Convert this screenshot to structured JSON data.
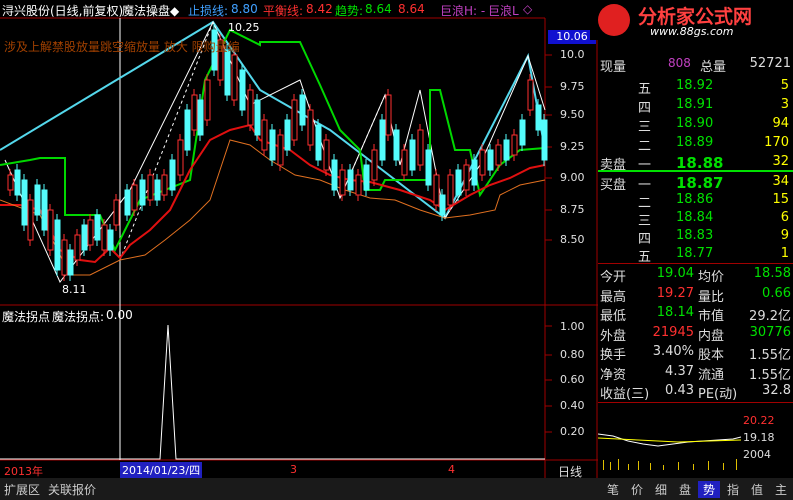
{
  "header": {
    "stock_title": "浔兴股份(日线,前复权)",
    "indicator_name": "魔法操盘◆",
    "stop_loss_label": "止损线:",
    "stop_loss_value": "8.80",
    "balance_label": "平衡线:",
    "balance_value": "8.42",
    "trend_label": "趋势:",
    "trend_value1": "8.64",
    "trend_value2": "8.64",
    "big_wave_h": "巨浪H: -",
    "big_wave_l": "巨浪L",
    "wave_marker": "◇"
  },
  "watermark": "涉及上解禁股放量跳空缩放量 放大 限购量编",
  "chart_annotations": {
    "high_label": "10.25",
    "low_label": "8.11",
    "current_price_box": "10.06"
  },
  "price_ticks": [
    "10.0",
    "9.75",
    "9.50",
    "9.25",
    "9.00",
    "8.75",
    "8.50"
  ],
  "sub_indicator": {
    "name": "魔法拐点",
    "label": "魔法拐点:",
    "value": "0.00",
    "ticks": [
      "1.00",
      "0.80",
      "0.60",
      "0.40",
      "0.20"
    ]
  },
  "time_axis": {
    "year_label": "2013年",
    "cursor_date": "2014/01/23/四",
    "month_3": "3",
    "month_4": "4",
    "period": "日线"
  },
  "logo": {
    "text": "分析家公式网",
    "url": "www.88gs.com"
  },
  "quote": {
    "current_label": "现量",
    "current_value": "808",
    "total_label": "总量",
    "total_value": "52721",
    "sell": [
      {
        "label": "五",
        "price": "18.92",
        "vol": "5"
      },
      {
        "label": "四",
        "price": "18.91",
        "vol": "3"
      },
      {
        "label": "三",
        "price": "18.90",
        "vol": "94"
      },
      {
        "label": "二",
        "price": "18.89",
        "vol": "170"
      },
      {
        "label": "一",
        "price": "18.88",
        "vol": "32"
      }
    ],
    "sell_label": "卖盘",
    "buy_label": "买盘",
    "buy": [
      {
        "label": "一",
        "price": "18.87",
        "vol": "34"
      },
      {
        "label": "二",
        "price": "18.86",
        "vol": "15"
      },
      {
        "label": "三",
        "price": "18.84",
        "vol": "6"
      },
      {
        "label": "四",
        "price": "18.83",
        "vol": "9"
      },
      {
        "label": "五",
        "price": "18.77",
        "vol": "1"
      }
    ],
    "stats": [
      {
        "l1": "今开",
        "v1": "19.04",
        "l2": "均价",
        "v2": "18.58"
      },
      {
        "l1": "最高",
        "v1": "19.27",
        "l2": "量比",
        "v2": "0.66"
      },
      {
        "l1": "最低",
        "v1": "18.14",
        "l2": "市值",
        "v2": "29.2亿"
      },
      {
        "l1": "外盘",
        "v1": "21945",
        "l2": "内盘",
        "v2": "30776"
      },
      {
        "l1": "换手",
        "v1": "3.40%",
        "l2": "股本",
        "v2": "1.55亿"
      },
      {
        "l1": "净资",
        "v1": "4.37",
        "l2": "流通",
        "v2": "1.55亿"
      },
      {
        "l1": "收益(三)",
        "v1": "0.43",
        "l2": "PE(动)",
        "v2": "32.8"
      }
    ],
    "mini_chart": {
      "high": "20.22",
      "mid": "19.18",
      "vol": "2004"
    }
  },
  "tabs": [
    "笔",
    "价",
    "细",
    "盘",
    "势",
    "指",
    "值",
    "主"
  ],
  "bottom_buttons": [
    "扩展区",
    "关联报价"
  ],
  "colors": {
    "up": "#ff3030",
    "down": "#54fcfc",
    "green": "#00e000",
    "yellow": "#ffff00",
    "magenta": "#c040c0",
    "red_line": "#ff0000"
  }
}
